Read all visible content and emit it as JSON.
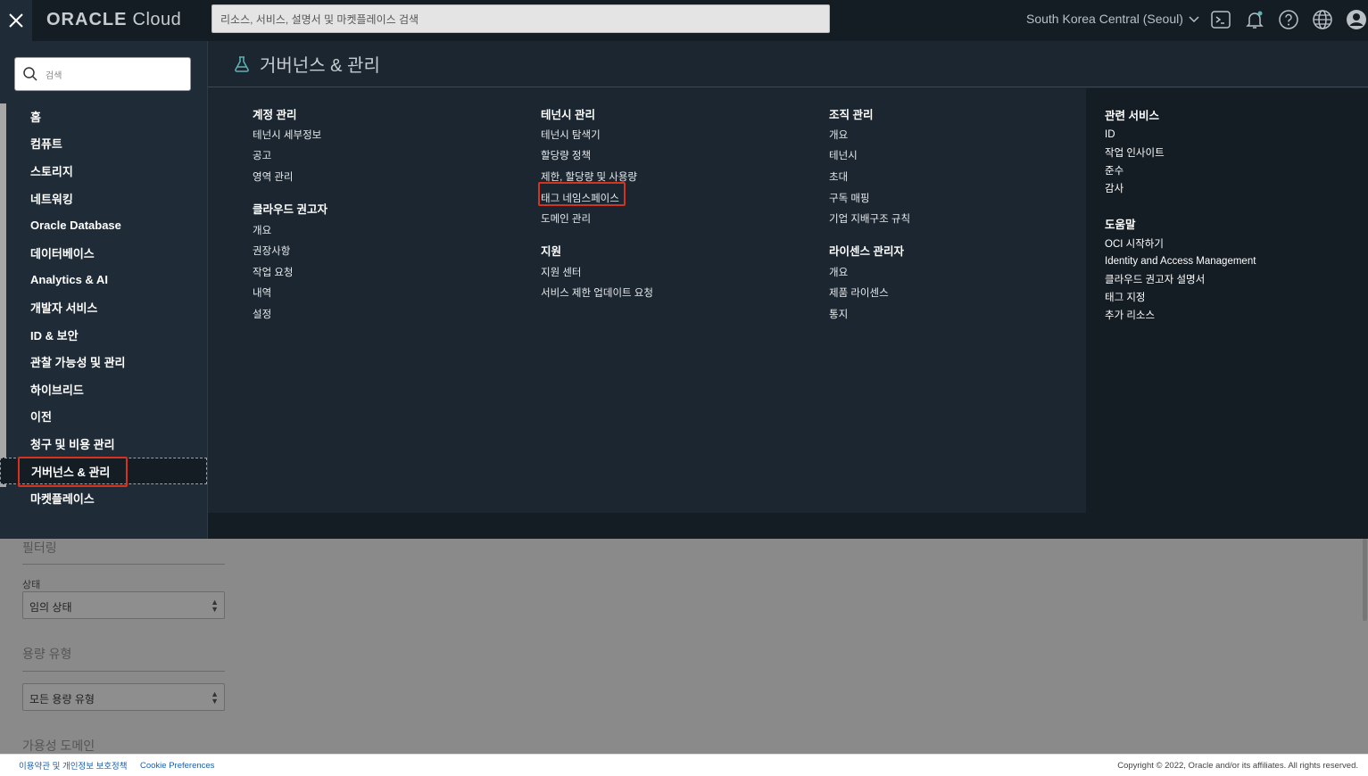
{
  "topbar": {
    "close_icon": "close-icon",
    "logo_brand": "ORACLE",
    "logo_product": "Cloud",
    "search_placeholder": "리소스, 서비스, 설명서 및 마켓플레이스 검색",
    "region": "South Korea Central (Seoul)",
    "icons": [
      "cloud-shell-icon",
      "bell-icon",
      "help-icon",
      "globe-icon",
      "profile-icon"
    ]
  },
  "left_nav": {
    "search_placeholder": "검색",
    "items": [
      "홈",
      "컴퓨트",
      "스토리지",
      "네트워킹",
      "Oracle Database",
      "데이터베이스",
      "Analytics & AI",
      "개발자 서비스",
      "ID & 보안",
      "관찰 가능성 및 관리",
      "하이브리드",
      "이전",
      "청구 및 비용 관리",
      "거버넌스 & 관리",
      "마켓플레이스"
    ],
    "active_item": "거버넌스 & 관리"
  },
  "panel": {
    "title": "거버넌스 & 관리",
    "columns": [
      {
        "groups": [
          {
            "title": "계정 관리",
            "links": [
              "테넌시 세부정보",
              "공고",
              "영역 관리"
            ]
          },
          {
            "title": "클라우드 권고자",
            "links": [
              "개요",
              "권장사항",
              "작업 요청",
              "내역",
              "설정"
            ]
          }
        ]
      },
      {
        "groups": [
          {
            "title": "테넌시 관리",
            "links": [
              "테넌시 탐색기",
              "할당량 정책",
              "제한, 할당량 및 사용량",
              "태그 네임스페이스",
              "도메인 관리"
            ]
          },
          {
            "title": "지원",
            "links": [
              "지원 센터",
              "서비스 제한 업데이트 요청"
            ]
          }
        ]
      },
      {
        "groups": [
          {
            "title": "조직 관리",
            "links": [
              "개요",
              "테넌시",
              "초대",
              "구독 매핑",
              "기업 지배구조 규칙"
            ]
          },
          {
            "title": "라이센스 관리자",
            "links": [
              "개요",
              "제품 라이센스",
              "통지"
            ]
          }
        ]
      }
    ],
    "related": [
      {
        "title": "관련 서비스",
        "links": [
          "ID",
          "작업 인사이트",
          "준수",
          "감사"
        ]
      },
      {
        "title": "도움말",
        "links": [
          "OCI 시작하기",
          "Identity and Access Management",
          "클라우드 권고자 설명서",
          "태그 지정",
          "추가 리소스"
        ]
      }
    ]
  },
  "background_page": {
    "filter_heading": "필터링",
    "state_label": "상태",
    "state_value": "임의 상태",
    "capacity_heading": "용량 유형",
    "capacity_value": "모든 용량 유형",
    "ad_heading": "가용성 도메인"
  },
  "footer": {
    "terms": "이용약관 및 개인정보 보호정책",
    "cookie": "Cookie Preferences",
    "copyright": "Copyright © 2022, Oracle and/or its affiliates. All rights reserved."
  },
  "colors": {
    "topbar_bg": "#141c24",
    "nav_bg": "#1f2b36",
    "highlight": "#d6331f",
    "accent_teal": "#5fb3b3"
  }
}
